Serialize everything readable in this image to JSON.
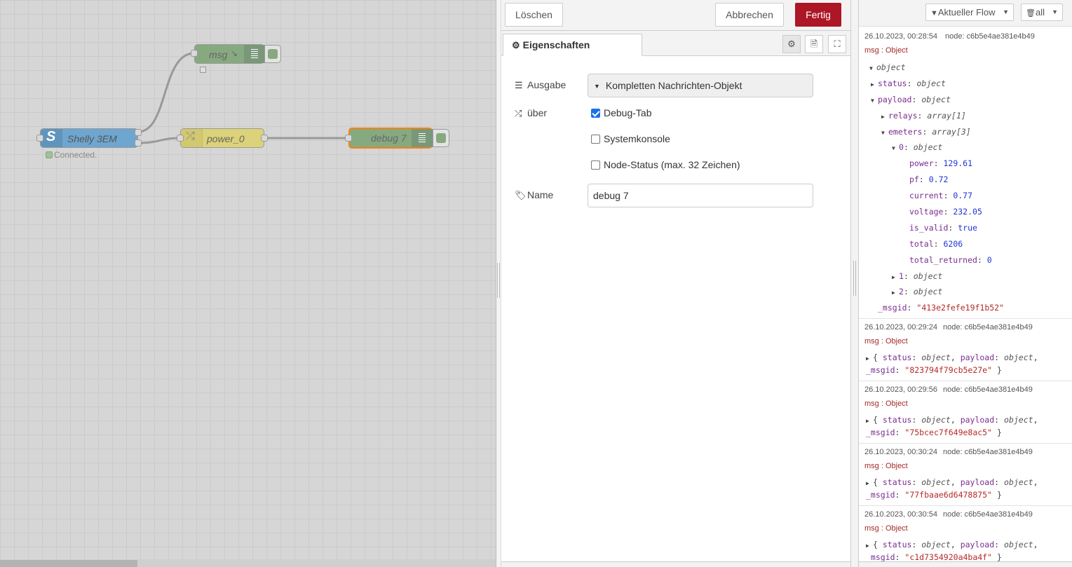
{
  "workspace": {
    "nodes": {
      "msg": {
        "label": "msg",
        "icon": "arrow-icon"
      },
      "shelly": {
        "label": "Shelly 3EM",
        "status": "Connected."
      },
      "change": {
        "label": "power_0"
      },
      "debug": {
        "label": "debug 7"
      }
    },
    "colors": {
      "shelly": "#6fa6cf",
      "change": "#dcd279",
      "debug": "#87a980",
      "wire": "#999999",
      "selected": "#ff7f0e"
    }
  },
  "tray": {
    "toolbar": {
      "delete_label": "Löschen",
      "cancel_label": "Abbrechen",
      "done_label": "Fertig"
    },
    "tabs": {
      "properties_label": "Eigenschaften"
    },
    "form": {
      "output_label": "Ausgabe",
      "output_value": "Kompletten Nachrichten-Objekt",
      "via_label": "über",
      "opt_debug_tab": "Debug-Tab",
      "opt_debug_tab_checked": true,
      "opt_console": "Systemkonsole",
      "opt_console_checked": false,
      "opt_status": "Node-Status (max. 32 Zeichen)",
      "opt_status_checked": false,
      "name_label": "Name",
      "name_value": "debug 7"
    }
  },
  "debug": {
    "filter_flow": "Aktueller Flow",
    "filter_all": "all",
    "messages": [
      {
        "time": "26.10.2023, 00:28:54",
        "node": "node: c6b5e4ae381e4b49",
        "topic": "msg : Object",
        "tree": {
          "root": "object",
          "status_key": "status",
          "status_type": "object",
          "payload_key": "payload",
          "payload_type": "object",
          "relays_key": "relays",
          "relays_type": "array[1]",
          "emeters_key": "emeters",
          "emeters_type": "array[3]",
          "e0_key": "0",
          "e0_type": "object",
          "power_key": "power",
          "power_val": "129.61",
          "pf_key": "pf",
          "pf_val": "0.72",
          "current_key": "current",
          "current_val": "0.77",
          "voltage_key": "voltage",
          "voltage_val": "232.05",
          "is_valid_key": "is_valid",
          "is_valid_val": "true",
          "total_key": "total",
          "total_val": "6206",
          "total_returned_key": "total_returned",
          "total_returned_val": "0",
          "e1_key": "1",
          "e1_type": "object",
          "e2_key": "2",
          "e2_type": "object",
          "msgid_key": "_msgid",
          "msgid_val": "\"413e2fefe19f1b52\""
        }
      },
      {
        "time": "26.10.2023, 00:29:24",
        "node": "node: c6b5e4ae381e4b49",
        "topic": "msg : Object",
        "msgid": "\"823794f79cb5e27e\""
      },
      {
        "time": "26.10.2023, 00:29:56",
        "node": "node: c6b5e4ae381e4b49",
        "topic": "msg : Object",
        "msgid": "\"75bcec7f649e8ac5\""
      },
      {
        "time": "26.10.2023, 00:30:24",
        "node": "node: c6b5e4ae381e4b49",
        "topic": "msg : Object",
        "msgid": "\"77fbaae6d6478875\""
      },
      {
        "time": "26.10.2023, 00:30:54",
        "node": "node: c6b5e4ae381e4b49",
        "topic": "msg : Object",
        "msgid": "\"c1d7354920a4ba4f\""
      }
    ],
    "summary": {
      "open": "{",
      "status_key": "status",
      "payload_key": "payload",
      "type": "object",
      "msgid_key": "_msgid",
      "close": "}"
    }
  }
}
